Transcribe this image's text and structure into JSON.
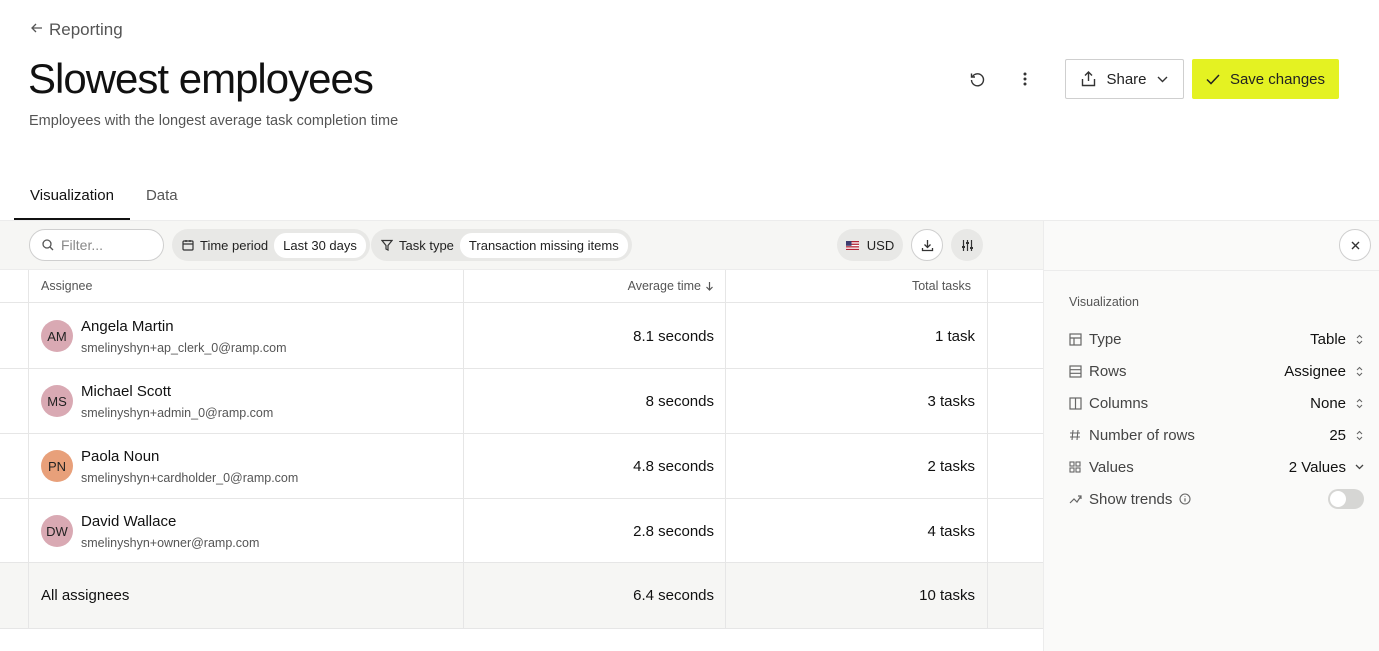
{
  "breadcrumb": {
    "label": "Reporting"
  },
  "page": {
    "title": "Slowest employees",
    "subtitle": "Employees with the longest average task completion time"
  },
  "header_actions": {
    "share_label": "Share",
    "save_label": "Save changes",
    "save_color": "#e4f222"
  },
  "tabs": [
    {
      "label": "Visualization",
      "active": true
    },
    {
      "label": "Data",
      "active": false
    }
  ],
  "toolbar": {
    "filter_placeholder": "Filter...",
    "chips": [
      {
        "label": "Time period",
        "value": "Last 30 days",
        "icon": "calendar-icon"
      },
      {
        "label": "Task type",
        "value": "Transaction missing items",
        "icon": "funnel-icon"
      }
    ],
    "currency": "USD"
  },
  "table": {
    "columns": [
      "Assignee",
      "Average time",
      "Total tasks"
    ],
    "rows": [
      {
        "initials": "AM",
        "name": "Angela Martin",
        "email": "smelinyshyn+ap_clerk_0@ramp.com",
        "avg_time": "8.1 seconds",
        "total": "1 task",
        "avatar_color": "#d9a9b3"
      },
      {
        "initials": "MS",
        "name": "Michael Scott",
        "email": "smelinyshyn+admin_0@ramp.com",
        "avg_time": "8 seconds",
        "total": "3 tasks",
        "avatar_color": "#d9a9b3"
      },
      {
        "initials": "PN",
        "name": "Paola Noun",
        "email": "smelinyshyn+cardholder_0@ramp.com",
        "avg_time": "4.8 seconds",
        "total": "2 tasks",
        "avatar_color": "#e8a07a"
      },
      {
        "initials": "DW",
        "name": "David Wallace",
        "email": "smelinyshyn+owner@ramp.com",
        "avg_time": "2.8 seconds",
        "total": "4 tasks",
        "avatar_color": "#d9a9b3"
      }
    ],
    "footer": {
      "label": "All assignees",
      "avg_time": "6.4 seconds",
      "total": "10 tasks"
    }
  },
  "side_panel": {
    "section_title": "Visualization",
    "settings": [
      {
        "label": "Type",
        "value": "Table",
        "icon": "table-icon",
        "caret": "updown"
      },
      {
        "label": "Rows",
        "value": "Assignee",
        "icon": "rows-icon",
        "caret": "updown"
      },
      {
        "label": "Columns",
        "value": "None",
        "icon": "columns-icon",
        "caret": "updown"
      },
      {
        "label": "Number of rows",
        "value": "25",
        "icon": "hash-icon",
        "caret": "updown"
      },
      {
        "label": "Values",
        "value": "2 Values",
        "icon": "grid-icon",
        "caret": "down"
      }
    ],
    "show_trends_label": "Show trends",
    "show_trends_enabled": false
  }
}
